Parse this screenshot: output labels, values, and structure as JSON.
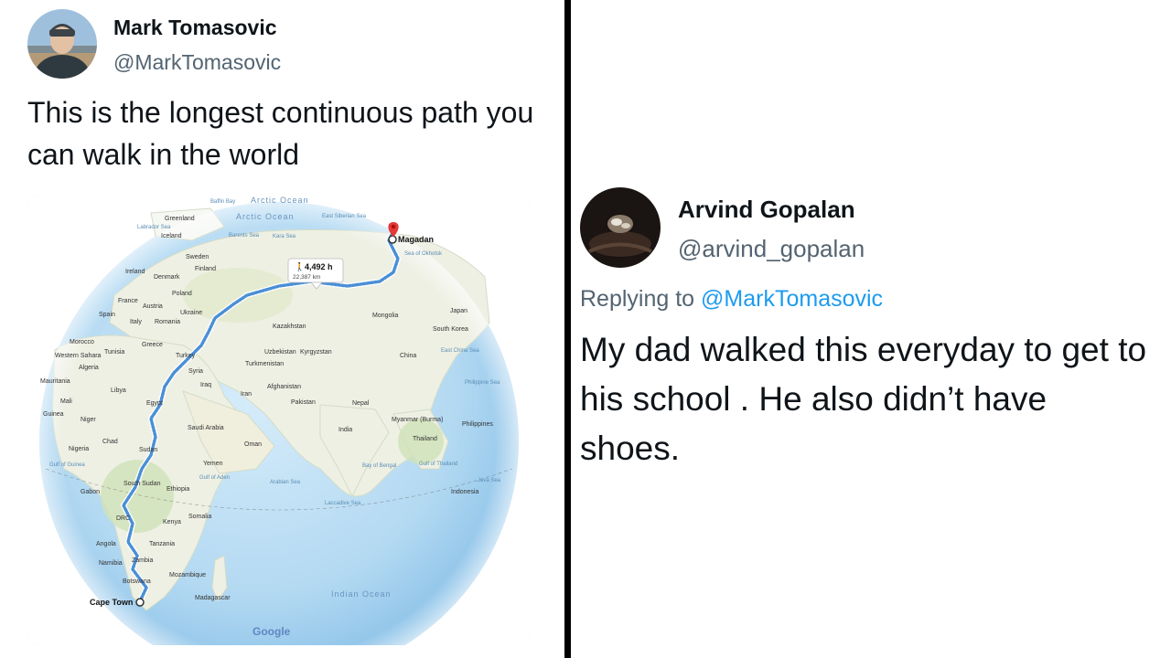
{
  "left_tweet": {
    "author_name": "Mark Tomasovic",
    "author_handle": "@MarkTomasovic",
    "text": "This is the longest continuous path you can walk in the world",
    "map": {
      "route_duration": "4,492 h",
      "route_distance": "22,387 km",
      "start": "Cape Town",
      "end": "Magadan",
      "watermark": "Google",
      "labels": {
        "arctic_ocean": "Arctic Ocean",
        "arctic_ocean_2": "Arctic Ocean",
        "baffin_bay": "Baffin Bay",
        "east_siberian_sea": "East Siberian Sea",
        "greenland": "Greenland",
        "labrador_sea": "Labrador Sea",
        "iceland": "Iceland",
        "barents_sea": "Barents Sea",
        "kara_sea": "Kara Sea",
        "sweden": "Sweden",
        "finland": "Finland",
        "ireland": "Ireland",
        "denmark": "Denmark",
        "poland": "Poland",
        "france": "France",
        "austria": "Austria",
        "ukraine": "Ukraine",
        "spain": "Spain",
        "italy": "Italy",
        "romania": "Romania",
        "kazakhstan": "Kazakhstan",
        "mongolia": "Mongolia",
        "japan": "Japan",
        "south_korea": "South Korea",
        "sea_of_okhotsk": "Sea of Okhotsk",
        "morocco": "Morocco",
        "tunisia": "Tunisia",
        "greece": "Greece",
        "turkey": "Turkey",
        "uzbekistan": "Uzbekistan",
        "kyrgyzstan": "Kyrgyzstan",
        "china": "China",
        "east_china_sea": "East China Sea",
        "western_sahara": "Western Sahara",
        "algeria": "Algeria",
        "turkmenistan": "Turkmenistan",
        "syria": "Syria",
        "iraq": "Iraq",
        "afghanistan": "Afghanistan",
        "iran": "Iran",
        "pakistan": "Pakistan",
        "nepal": "Nepal",
        "philippine_sea": "Philippine Sea",
        "mauritania": "Mauritania",
        "libya": "Libya",
        "mali": "Mali",
        "egypt": "Egypt",
        "guinea": "Guinea",
        "niger": "Niger",
        "saudi_arabia": "Saudi Arabia",
        "india": "India",
        "myanmar": "Myanmar (Burma)",
        "philippines": "Philippines",
        "thailand": "Thailand",
        "chad": "Chad",
        "oman": "Oman",
        "nigeria": "Nigeria",
        "sudan": "Sudan",
        "yemen": "Yemen",
        "bay_of_bengal": "Bay of Bengal",
        "gulf_of_thailand": "Gulf of Thailand",
        "gulf_of_guinea": "Gulf of Guinea",
        "gulf_of_aden": "Gulf of Aden",
        "arabian_sea": "Arabian Sea",
        "south_sudan": "South Sudan",
        "ethiopia": "Ethiopia",
        "gabon": "Gabon",
        "laccadive_sea": "Laccadive Sea",
        "indonesia": "Indonesia",
        "java_sea": "Java Sea",
        "drc": "DRC",
        "kenya": "Kenya",
        "somalia": "Somalia",
        "angola": "Angola",
        "tanzania": "Tanzania",
        "namibia": "Namibia",
        "zambia": "Zambia",
        "mozambique": "Mozambique",
        "botswana": "Botswana",
        "madagascar": "Madagascar",
        "indian_ocean": "Indian Ocean"
      }
    }
  },
  "right_tweet": {
    "author_name": "Arvind Gopalan",
    "author_handle": "@arvind_gopalan",
    "replying_prefix": "Replying to",
    "replying_to": "@MarkTomasovic",
    "text": "My dad walked this everyday to get to his school . He also didn’t have shoes."
  },
  "colors": {
    "handle_gray": "#536471",
    "link_blue": "#1d9bf0",
    "route_blue": "#4a8fd6",
    "pin_red": "#e53935"
  }
}
